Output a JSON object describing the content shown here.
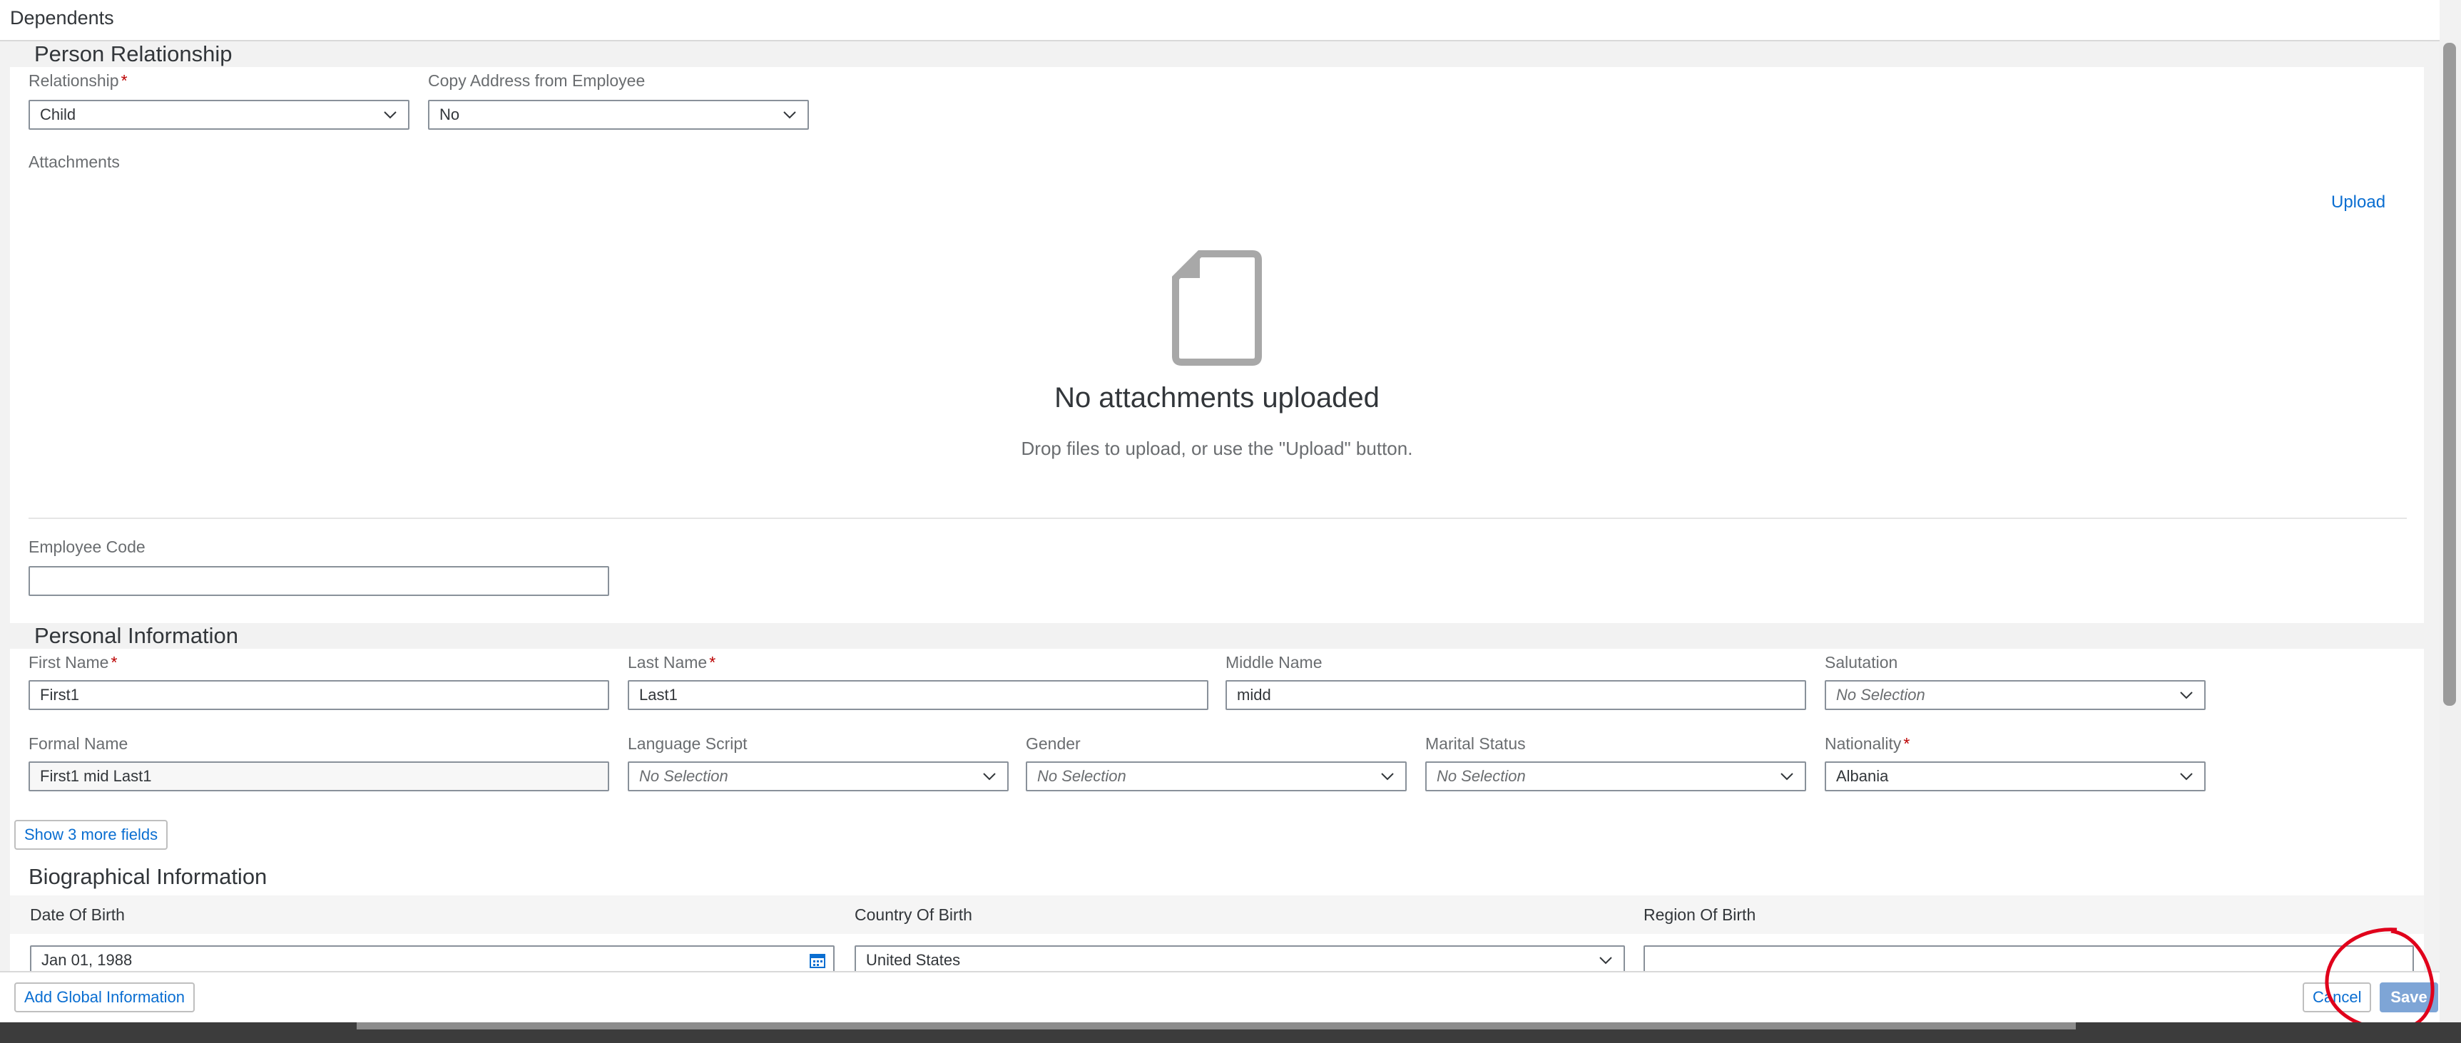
{
  "window": {
    "title": "Dependents"
  },
  "person_relationship": {
    "title": "Person Relationship",
    "relationship": {
      "label": "Relationship",
      "value": "Child"
    },
    "copy_address": {
      "label": "Copy Address from Employee",
      "value": "No"
    },
    "attachments": {
      "label": "Attachments",
      "upload_label": "Upload",
      "empty_title": "No attachments uploaded",
      "empty_hint": "Drop files to upload, or use the \"Upload\" button."
    },
    "employee_code": {
      "label": "Employee Code",
      "value": ""
    }
  },
  "personal_information": {
    "title": "Personal Information",
    "first_name": {
      "label": "First Name",
      "value": "First1"
    },
    "last_name": {
      "label": "Last Name",
      "value": "Last1"
    },
    "middle_name": {
      "label": "Middle Name",
      "value": "midd"
    },
    "salutation": {
      "label": "Salutation",
      "value": "No Selection"
    },
    "formal_name": {
      "label": "Formal Name",
      "value": "First1 mid Last1"
    },
    "language_script": {
      "label": "Language Script",
      "value": "No Selection"
    },
    "gender": {
      "label": "Gender",
      "value": "No Selection"
    },
    "marital_status": {
      "label": "Marital Status",
      "value": "No Selection"
    },
    "nationality": {
      "label": "Nationality",
      "value": "Albania"
    },
    "more_fields_label": "Show 3 more fields"
  },
  "biographical_information": {
    "title": "Biographical Information",
    "date_of_birth": {
      "label": "Date Of Birth",
      "value": "Jan 01, 1988"
    },
    "country_of_birth": {
      "label": "Country Of Birth",
      "value": "United States"
    },
    "region_of_birth": {
      "label": "Region Of Birth",
      "value": ""
    }
  },
  "footer": {
    "add_global_label": "Add Global Information",
    "cancel_label": "Cancel",
    "save_label": "Save"
  },
  "colors": {
    "accent": "#0a6ed1",
    "required": "#bb0000",
    "save_button": "#7ea5d6",
    "annotation": "#e0001b"
  },
  "icons": [
    "chevron-down-icon",
    "document-icon",
    "calendar-icon"
  ]
}
